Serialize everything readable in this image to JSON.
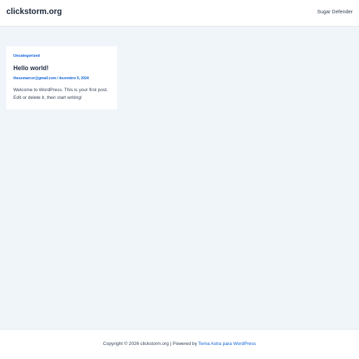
{
  "header": {
    "site_title": "clickstorm.org",
    "nav_items": [
      "Sugar Defender"
    ]
  },
  "post": {
    "category": "Uncategorized",
    "title": "Hello world!",
    "author": "theusmarcor@gmail.com",
    "separator": " / ",
    "date": "dezembro 5, 2024",
    "excerpt": "Welcome to WordPress. This is your first post. Edit or delete it, then start writing!"
  },
  "footer": {
    "copyright": "Copyright © 2026 clickstorm.org | Powered by ",
    "theme_link": "Tema Astra para WordPress"
  },
  "colors": {
    "accent": "#0b5fd6",
    "background": "#f0f5fa",
    "surface": "#ffffff",
    "heading": "#1e293b"
  }
}
